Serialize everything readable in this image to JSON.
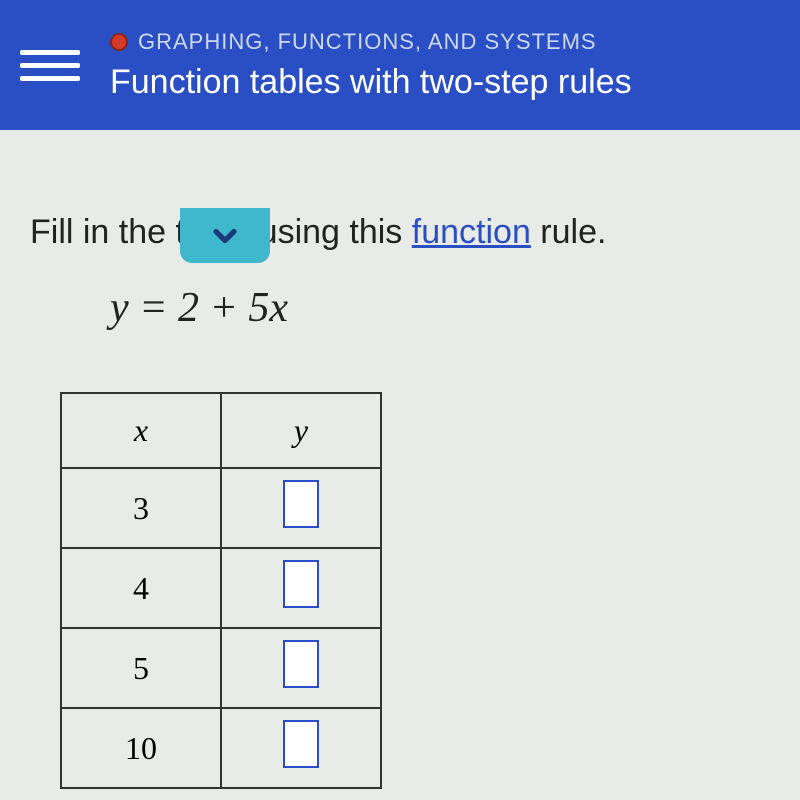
{
  "header": {
    "breadcrumb": "GRAPHING, FUNCTIONS, AND SYSTEMS",
    "title": "Function tables with two-step rules"
  },
  "instruction": {
    "prefix": "Fill in the table using this ",
    "link": "function",
    "suffix": " rule."
  },
  "equation": "y = 2 + 5x",
  "table": {
    "headers": {
      "x": "x",
      "y": "y"
    },
    "rows": [
      {
        "x": "3",
        "y": ""
      },
      {
        "x": "4",
        "y": ""
      },
      {
        "x": "5",
        "y": ""
      },
      {
        "x": "10",
        "y": ""
      }
    ]
  }
}
